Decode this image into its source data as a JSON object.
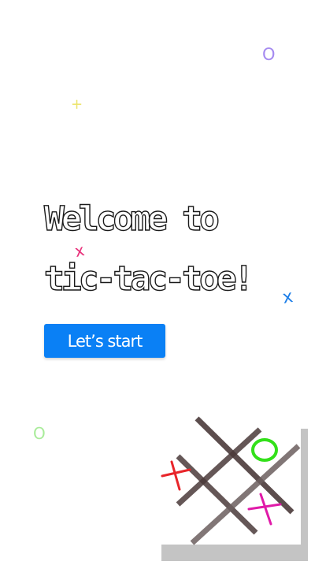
{
  "decorations": {
    "purple_o": "O",
    "yellow_plus": "+",
    "pink_x": "x",
    "blue_x": "x",
    "green_o": "O"
  },
  "hero": {
    "title_line1": "Welcome to",
    "title_line2": "tic-tac-toe!"
  },
  "actions": {
    "start_label": "Let’s start"
  },
  "board_illustration": {
    "marks": [
      {
        "symbol": "X",
        "color": "#e8252a"
      },
      {
        "symbol": "O",
        "color": "#33e01a"
      },
      {
        "symbol": "X",
        "color": "#e01aa8"
      }
    ],
    "line_colors": [
      "#4a3a3a",
      "#6b5e5e"
    ]
  }
}
